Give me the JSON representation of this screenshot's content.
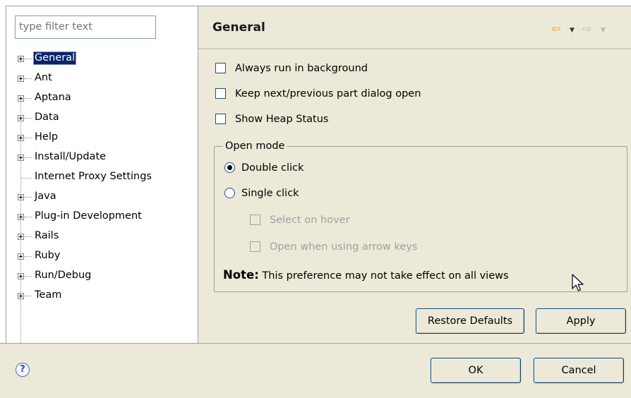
{
  "filter": {
    "placeholder": "type filter text"
  },
  "tree": {
    "items": [
      {
        "label": "General",
        "expandable": true,
        "selected": true
      },
      {
        "label": "Ant",
        "expandable": true
      },
      {
        "label": "Aptana",
        "expandable": true
      },
      {
        "label": "Data",
        "expandable": true
      },
      {
        "label": "Help",
        "expandable": true
      },
      {
        "label": "Install/Update",
        "expandable": true
      },
      {
        "label": "Internet Proxy Settings",
        "expandable": false
      },
      {
        "label": "Java",
        "expandable": true
      },
      {
        "label": "Plug-in Development",
        "expandable": true
      },
      {
        "label": "Rails",
        "expandable": true
      },
      {
        "label": "Ruby",
        "expandable": true
      },
      {
        "label": "Run/Debug",
        "expandable": true
      },
      {
        "label": "Team",
        "expandable": true
      }
    ]
  },
  "page": {
    "title": "General",
    "nav": {
      "back_icon": "back-arrow-icon",
      "forward_icon": "forward-arrow-icon",
      "back_color": "#f0b400"
    },
    "options": [
      {
        "label": "Always run in background",
        "checked": false
      },
      {
        "label": "Keep next/previous part dialog open",
        "checked": false
      },
      {
        "label": "Show Heap Status",
        "checked": false
      }
    ],
    "open_mode": {
      "legend": "Open mode",
      "double_click": "Double click",
      "single_click": "Single click",
      "selected": "Double click",
      "select_on_hover": "Select on hover",
      "open_arrow_keys": "Open when using arrow keys",
      "note_label": "Note:",
      "note_text": "This preference may not take effect on all views"
    },
    "restore_defaults": "Restore Defaults",
    "apply": "Apply"
  },
  "footer": {
    "help_icon": "help-icon",
    "ok": "OK",
    "cancel": "Cancel"
  },
  "colors": {
    "panel_bg": "#ece9d8",
    "selection_bg": "#0a246a",
    "disabled_text": "#a0a0a0"
  }
}
